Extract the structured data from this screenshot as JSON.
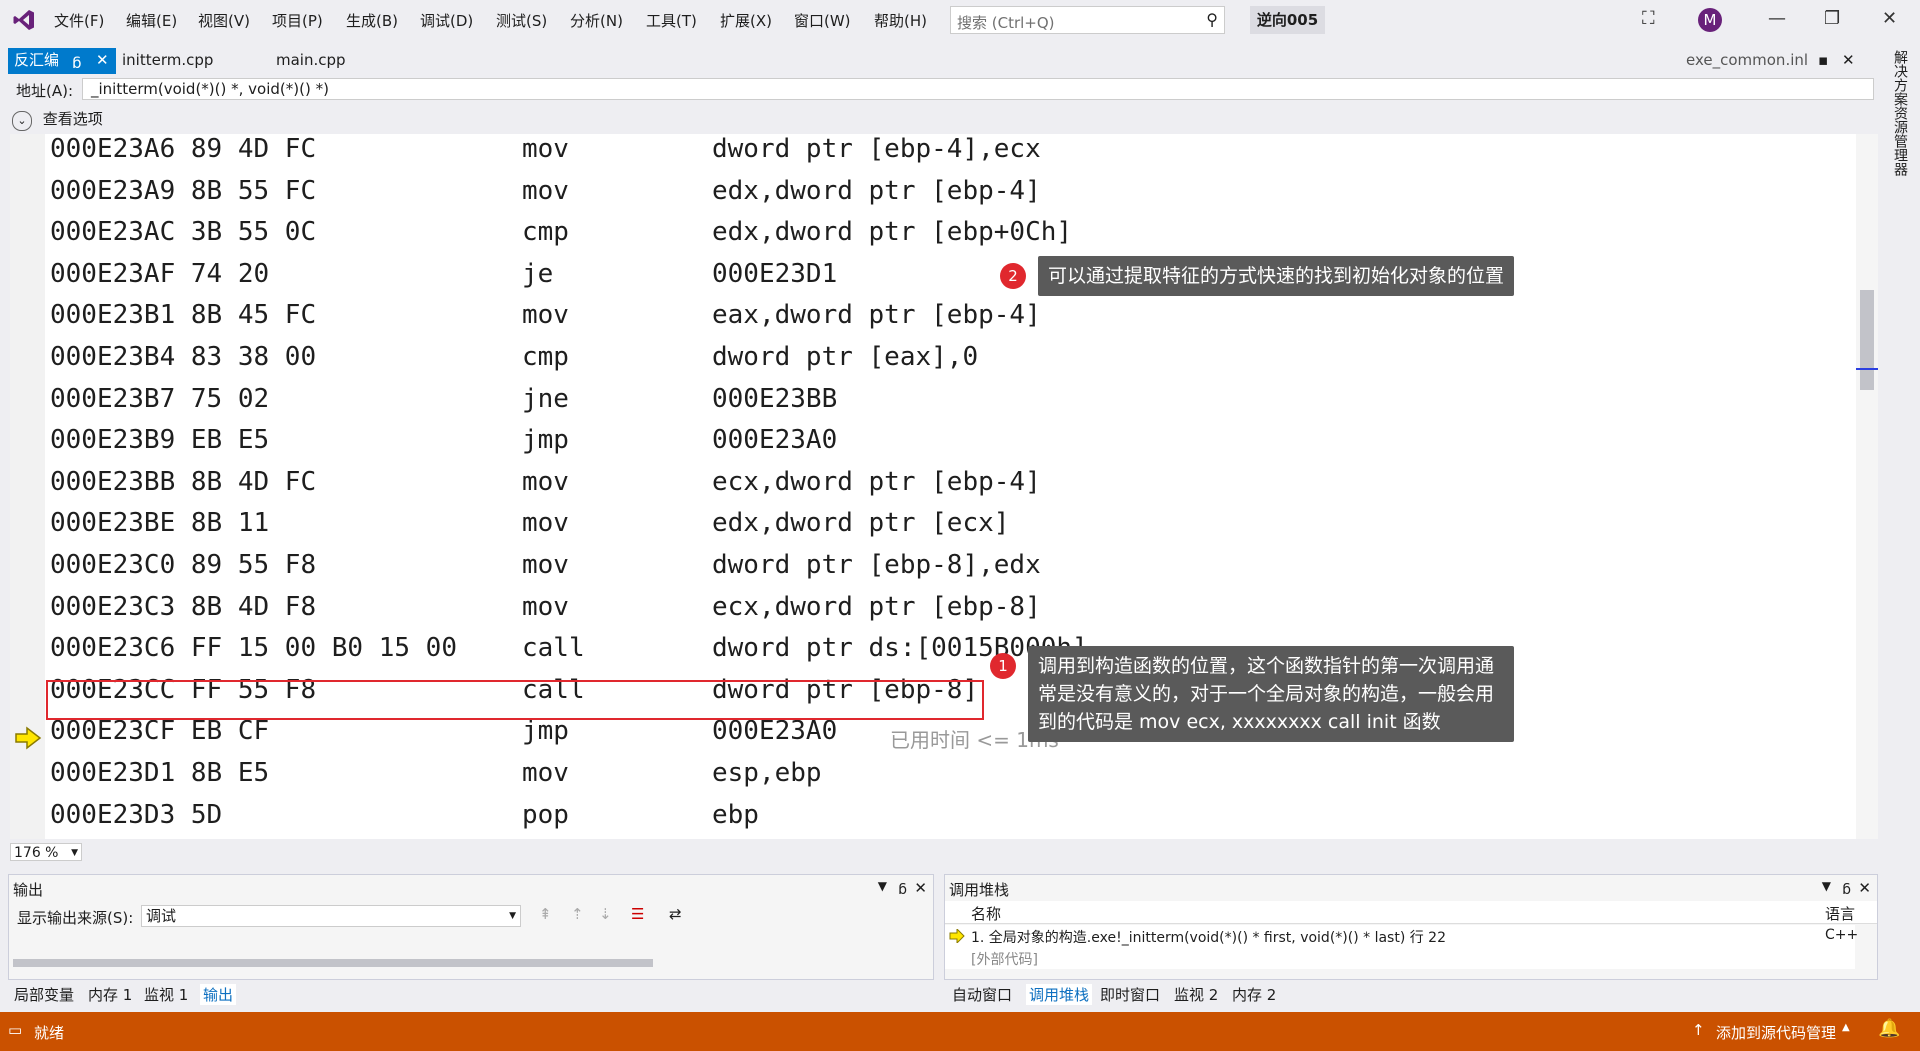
{
  "app": {
    "logo": "visual-studio-logo",
    "solution_name": "逆向005",
    "avatar_letter": "M"
  },
  "menu": [
    "文件(F)",
    "编辑(E)",
    "视图(V)",
    "项目(P)",
    "生成(B)",
    "调试(D)",
    "测试(S)",
    "分析(N)",
    "工具(T)",
    "扩展(X)",
    "窗口(W)",
    "帮助(H)"
  ],
  "search": {
    "placeholder": "搜索 (Ctrl+Q)"
  },
  "tabs": {
    "active": "反汇编",
    "pin_glyph": "ᵷ",
    "items": [
      "initterm.cpp",
      "main.cpp"
    ],
    "right_tab": "exe_common.inl"
  },
  "address": {
    "label": "地址(A):",
    "value": "_initterm(void(*)() *, void(*)() *)"
  },
  "view_options": "查看选项",
  "sidebar_right": "解决方案资源管理器",
  "disasm": [
    {
      "addr": "000E23A6",
      "bytes": "89 4D FC",
      "mnemonic": "mov",
      "operands": "dword ptr [ebp-4],ecx"
    },
    {
      "addr": "000E23A9",
      "bytes": "8B 55 FC",
      "mnemonic": "mov",
      "operands": "edx,dword ptr [ebp-4]"
    },
    {
      "addr": "000E23AC",
      "bytes": "3B 55 0C",
      "mnemonic": "cmp",
      "operands": "edx,dword ptr [ebp+0Ch]"
    },
    {
      "addr": "000E23AF",
      "bytes": "74 20",
      "mnemonic": "je",
      "operands": "000E23D1"
    },
    {
      "addr": "000E23B1",
      "bytes": "8B 45 FC",
      "mnemonic": "mov",
      "operands": "eax,dword ptr [ebp-4]"
    },
    {
      "addr": "000E23B4",
      "bytes": "83 38 00",
      "mnemonic": "cmp",
      "operands": "dword ptr [eax],0"
    },
    {
      "addr": "000E23B7",
      "bytes": "75 02",
      "mnemonic": "jne",
      "operands": "000E23BB"
    },
    {
      "addr": "000E23B9",
      "bytes": "EB E5",
      "mnemonic": "jmp",
      "operands": "000E23A0"
    },
    {
      "addr": "000E23BB",
      "bytes": "8B 4D FC",
      "mnemonic": "mov",
      "operands": "ecx,dword ptr [ebp-4]"
    },
    {
      "addr": "000E23BE",
      "bytes": "8B 11",
      "mnemonic": "mov",
      "operands": "edx,dword ptr [ecx]"
    },
    {
      "addr": "000E23C0",
      "bytes": "89 55 F8",
      "mnemonic": "mov",
      "operands": "dword ptr [ebp-8],edx"
    },
    {
      "addr": "000E23C3",
      "bytes": "8B 4D F8",
      "mnemonic": "mov",
      "operands": "ecx,dword ptr [ebp-8]"
    },
    {
      "addr": "000E23C6",
      "bytes": "FF 15 00 B0 15 00",
      "mnemonic": "call",
      "operands": "dword ptr ds:[0015B000h]"
    },
    {
      "addr": "000E23CC",
      "bytes": "FF 55 F8",
      "mnemonic": "call",
      "operands": "dword ptr [ebp-8]"
    },
    {
      "addr": "000E23CF",
      "bytes": "EB CF",
      "mnemonic": "jmp",
      "operands": "000E23A0"
    },
    {
      "addr": "000E23D1",
      "bytes": "8B E5",
      "mnemonic": "mov",
      "operands": "esp,ebp"
    },
    {
      "addr": "000E23D3",
      "bytes": "5D",
      "mnemonic": "pop",
      "operands": "ebp"
    }
  ],
  "elapsed": "已用时间 <= 1ms",
  "callout1": {
    "badge": "1",
    "text": "调用到构造函数的位置，这个函数指针的第一次调用通常是没有意义的，对于一个全局对象的构造，一般会用到的代码是 mov ecx, xxxxxxxx call init 函数"
  },
  "callout2": {
    "badge": "2",
    "text": "可以通过提取特征的方式快速的找到初始化对象的位置"
  },
  "zoom": "176 %",
  "output": {
    "title": "输出",
    "source_label": "显示输出来源(S):",
    "source_value": "调试",
    "tabs": [
      "局部变量",
      "内存 1",
      "监视 1",
      "输出"
    ],
    "active_tab": "输出"
  },
  "callstack": {
    "title": "调用堆栈",
    "col_name": "名称",
    "col_lang": "语言",
    "rows": [
      {
        "name": "1. 全局对象的构造.exe!_initterm(void(*)() * first, void(*)() * last) 行 22",
        "lang": "C++"
      },
      {
        "name": "[外部代码]",
        "lang": ""
      }
    ],
    "tabs": [
      "自动窗口",
      "调用堆栈",
      "即时窗口",
      "监视 2",
      "内存 2"
    ],
    "active_tab": "调用堆栈"
  },
  "status": {
    "left": "就绪",
    "right": "添加到源代码管理"
  },
  "colors": {
    "accent": "#ca5100",
    "highlight_box": "#e0282e",
    "tab_active": "#007acc",
    "vs_purple": "#68217a"
  }
}
